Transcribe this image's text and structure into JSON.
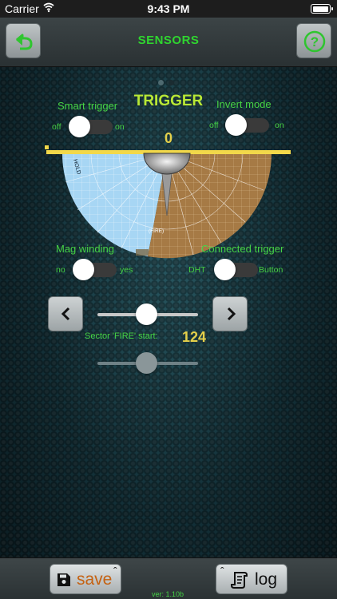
{
  "status_bar": {
    "carrier": "Carrier",
    "time": "9:43 PM"
  },
  "header": {
    "title": "SENSORS",
    "back_icon": "back-arrow-icon",
    "help_icon": "help-icon",
    "accent": "#2fd52f"
  },
  "trigger": {
    "title": "TRIGGER",
    "smart_trigger": {
      "label": "Smart trigger",
      "off": "off",
      "on": "on",
      "state": "off"
    },
    "invert_mode": {
      "label": "Invert mode",
      "off": "off",
      "on": "on",
      "state": "off"
    },
    "value": "0"
  },
  "gauge": {
    "left_label": "HOLD",
    "right_label": "(FIRE)",
    "left_color": "#a7d6f4",
    "right_color": "#a67a45",
    "bar_color": "#f2d84a"
  },
  "mag_winding": {
    "label": "Mag winding",
    "off": "no",
    "on": "yes",
    "state": "no"
  },
  "connected_trigger": {
    "label": "Connected trigger",
    "off": "DHT",
    "on": "Button",
    "state": "DHT"
  },
  "sector": {
    "label": "Sector 'FIRE' start:",
    "value": "124"
  },
  "footer": {
    "save_label": "save",
    "log_label": "log",
    "caret": "ˆ",
    "version": "ver: 1.10b"
  }
}
